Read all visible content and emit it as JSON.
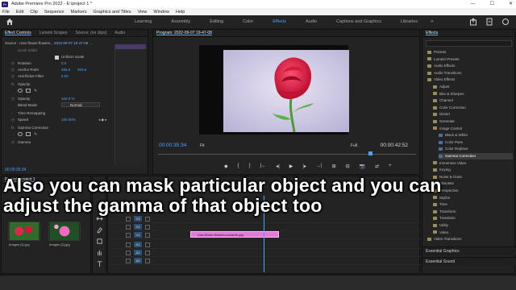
{
  "window": {
    "title": "Adobe Premiere Pro 2022 - E:\\project 1 *",
    "logo_text": "Pr",
    "controls": [
      "—",
      "☐",
      "✕"
    ]
  },
  "menu": [
    "File",
    "Edit",
    "Clip",
    "Sequence",
    "Markers",
    "Graphics and Titles",
    "View",
    "Window",
    "Help"
  ],
  "workspaces": {
    "tabs": [
      "Learning",
      "Assembly",
      "Editing",
      "Color",
      "Effects",
      "Audio",
      "Captions and Graphics",
      "Libraries"
    ],
    "active": "Effects",
    "more": "»"
  },
  "effect_controls": {
    "tabs": [
      "Effect Controls",
      "Lumetri Scopes",
      "Source: (no clips)",
      "Audio"
    ],
    "source_label": "Source - rose-flower-flowers...",
    "clip_label": "2022-09-07 19-47-08 ...",
    "rows": [
      {
        "label": "Scale Width",
        "v1": "",
        "v2": ""
      },
      {
        "label": "Uniform Scale",
        "v1": "",
        "v2": ""
      },
      {
        "label": "Rotation",
        "v1": "0.0",
        "v2": ""
      },
      {
        "label": "Anchor Point",
        "v1": "455.0",
        "v2": "303.5"
      },
      {
        "label": "Anti-flicker Filter",
        "v1": "0.00",
        "v2": ""
      },
      {
        "label": "Opacity",
        "v1": "",
        "v2": ""
      },
      {
        "label": "Opacity",
        "v1": "100.0 %",
        "v2": ""
      },
      {
        "label": "Blend Mode",
        "v1": "Normal",
        "v2": ""
      },
      {
        "label": "Time Remapping",
        "v1": "",
        "v2": ""
      },
      {
        "label": "Speed",
        "v1": "100.00%",
        "v2": ""
      },
      {
        "label": "Gamma Correction",
        "v1": "",
        "v2": ""
      },
      {
        "label": "Gamma",
        "v1": "",
        "v2": ""
      }
    ],
    "timecode": "00:00:35:34"
  },
  "program_monitor": {
    "title": "Program: 2022-09-07 19-47-08",
    "timecode_current": "00:00:35:34",
    "timecode_total": "00:00:42:52",
    "fit": "Fit",
    "resolution": "Full",
    "controls": [
      "◆",
      "{",
      "}",
      "|←",
      "◂|",
      "▶",
      "|▸",
      "→|",
      "⊞",
      "⊟",
      "📷",
      "⇄",
      "+"
    ]
  },
  "effects_panel": {
    "title": "Effects",
    "items": [
      {
        "label": "Presets",
        "kind": "folder",
        "indent": 0,
        "selected": false
      },
      {
        "label": "Lumetri Presets",
        "kind": "folder",
        "indent": 0,
        "selected": false
      },
      {
        "label": "Audio Effects",
        "kind": "folder",
        "indent": 0,
        "selected": false
      },
      {
        "label": "Audio Transitions",
        "kind": "folder",
        "indent": 0,
        "selected": false
      },
      {
        "label": "Video Effects",
        "kind": "folder",
        "indent": 0,
        "selected": false
      },
      {
        "label": "Adjust",
        "kind": "folder",
        "indent": 1,
        "selected": false
      },
      {
        "label": "Blur & Sharpen",
        "kind": "folder",
        "indent": 1,
        "selected": false
      },
      {
        "label": "Channel",
        "kind": "folder",
        "indent": 1,
        "selected": false
      },
      {
        "label": "Color Correction",
        "kind": "folder",
        "indent": 1,
        "selected": false
      },
      {
        "label": "Distort",
        "kind": "folder",
        "indent": 1,
        "selected": false
      },
      {
        "label": "Generate",
        "kind": "folder",
        "indent": 1,
        "selected": false
      },
      {
        "label": "Image Control",
        "kind": "folder",
        "indent": 1,
        "selected": false
      },
      {
        "label": "Black & White",
        "kind": "effect",
        "indent": 2,
        "selected": false
      },
      {
        "label": "Color Pass",
        "kind": "effect",
        "indent": 2,
        "selected": false
      },
      {
        "label": "Color Replace",
        "kind": "effect",
        "indent": 2,
        "selected": false
      },
      {
        "label": "Gamma Correction",
        "kind": "effect",
        "indent": 2,
        "selected": true
      },
      {
        "label": "Immersive Video",
        "kind": "folder",
        "indent": 1,
        "selected": false
      },
      {
        "label": "Keying",
        "kind": "folder",
        "indent": 1,
        "selected": false
      },
      {
        "label": "Noise & Grain",
        "kind": "folder",
        "indent": 1,
        "selected": false
      },
      {
        "label": "Obsolete",
        "kind": "folder",
        "indent": 1,
        "selected": false
      },
      {
        "label": "Perspective",
        "kind": "folder",
        "indent": 1,
        "selected": false
      },
      {
        "label": "Stylize",
        "kind": "folder",
        "indent": 1,
        "selected": false
      },
      {
        "label": "Time",
        "kind": "folder",
        "indent": 1,
        "selected": false
      },
      {
        "label": "Transform",
        "kind": "folder",
        "indent": 1,
        "selected": false
      },
      {
        "label": "Transition",
        "kind": "folder",
        "indent": 1,
        "selected": false
      },
      {
        "label": "Utility",
        "kind": "folder",
        "indent": 1,
        "selected": false
      },
      {
        "label": "Video",
        "kind": "folder",
        "indent": 1,
        "selected": false
      },
      {
        "label": "Video Transitions",
        "kind": "folder",
        "indent": 0,
        "selected": false
      }
    ],
    "bottom_panels": [
      "Essential Graphics",
      "Essential Sound"
    ]
  },
  "project": {
    "tab": "Project: project 1",
    "thumbnails": [
      {
        "label": "Images (1).jpg"
      },
      {
        "label": "Images (2).jpg"
      }
    ]
  },
  "timeline": {
    "tracks": [
      {
        "name": "V3"
      },
      {
        "name": "V2"
      },
      {
        "name": "V1"
      },
      {
        "name": "A1"
      },
      {
        "name": "A2"
      },
      {
        "name": "A3"
      }
    ],
    "clip_label": "rose-flower-flowers-romantic.jpg"
  },
  "caption": {
    "line1": "Also you can mask particular object and you can",
    "line2": "adjust the gamma of that object too"
  },
  "colors": {
    "accent": "#4aa3ff",
    "clip_pink": "#e27ad8"
  }
}
